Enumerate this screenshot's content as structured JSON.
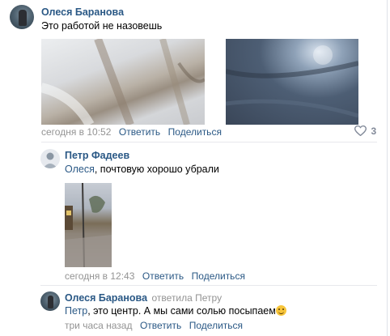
{
  "post": {
    "author": "Олеся Баранова",
    "text": "Это работой не назовешь",
    "time": "сегодня в 10:52",
    "reply_label": "Ответить",
    "share_label": "Поделиться",
    "likes": "3",
    "heart_icon": "heart-outline-icon"
  },
  "comment1": {
    "author": "Петр Фадеев",
    "mention": "Олеся",
    "text_rest": ", почтовую хорошо убрали",
    "time": "сегодня в 12:43",
    "reply_label": "Ответить",
    "share_label": "Поделиться"
  },
  "comment2": {
    "author": "Олеся Баранова",
    "replied_to": "ответила Петру",
    "mention": "Петр",
    "text_rest": ", это центр. А мы сами солью посыпаем",
    "emoji": "grinning-emoji",
    "time": "три часа назад",
    "reply_label": "Ответить",
    "share_label": "Поделиться"
  },
  "colors": {
    "link": "#2a5885",
    "meta": "#939393",
    "divider": "#e7e8ec"
  }
}
